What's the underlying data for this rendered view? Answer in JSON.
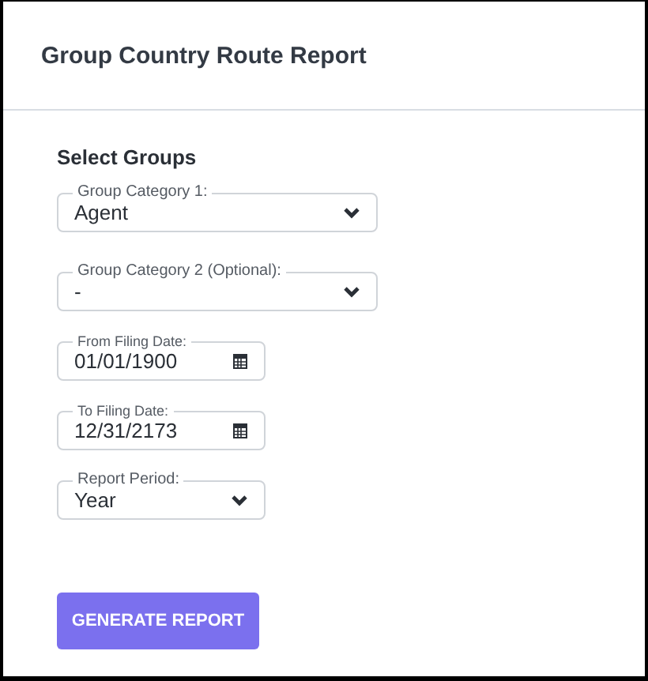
{
  "title": "Group Country Route Report",
  "section": {
    "heading": "Select Groups"
  },
  "fields": [
    {
      "kind": "select",
      "label": "Group Category 1:",
      "value": "Agent",
      "wide": true
    },
    {
      "kind": "select",
      "label": "Group Category 2 (Optional):",
      "value": "-",
      "wide": true
    },
    {
      "kind": "date",
      "label": "From Filing Date:",
      "value": "01/01/1900",
      "wide": false
    },
    {
      "kind": "date",
      "label": "To Filing Date:",
      "value": "12/31/2173",
      "wide": false
    },
    {
      "kind": "select",
      "label": "Report Period:",
      "value": "Year",
      "wide": false
    }
  ],
  "button": "GENERATE REPORT"
}
